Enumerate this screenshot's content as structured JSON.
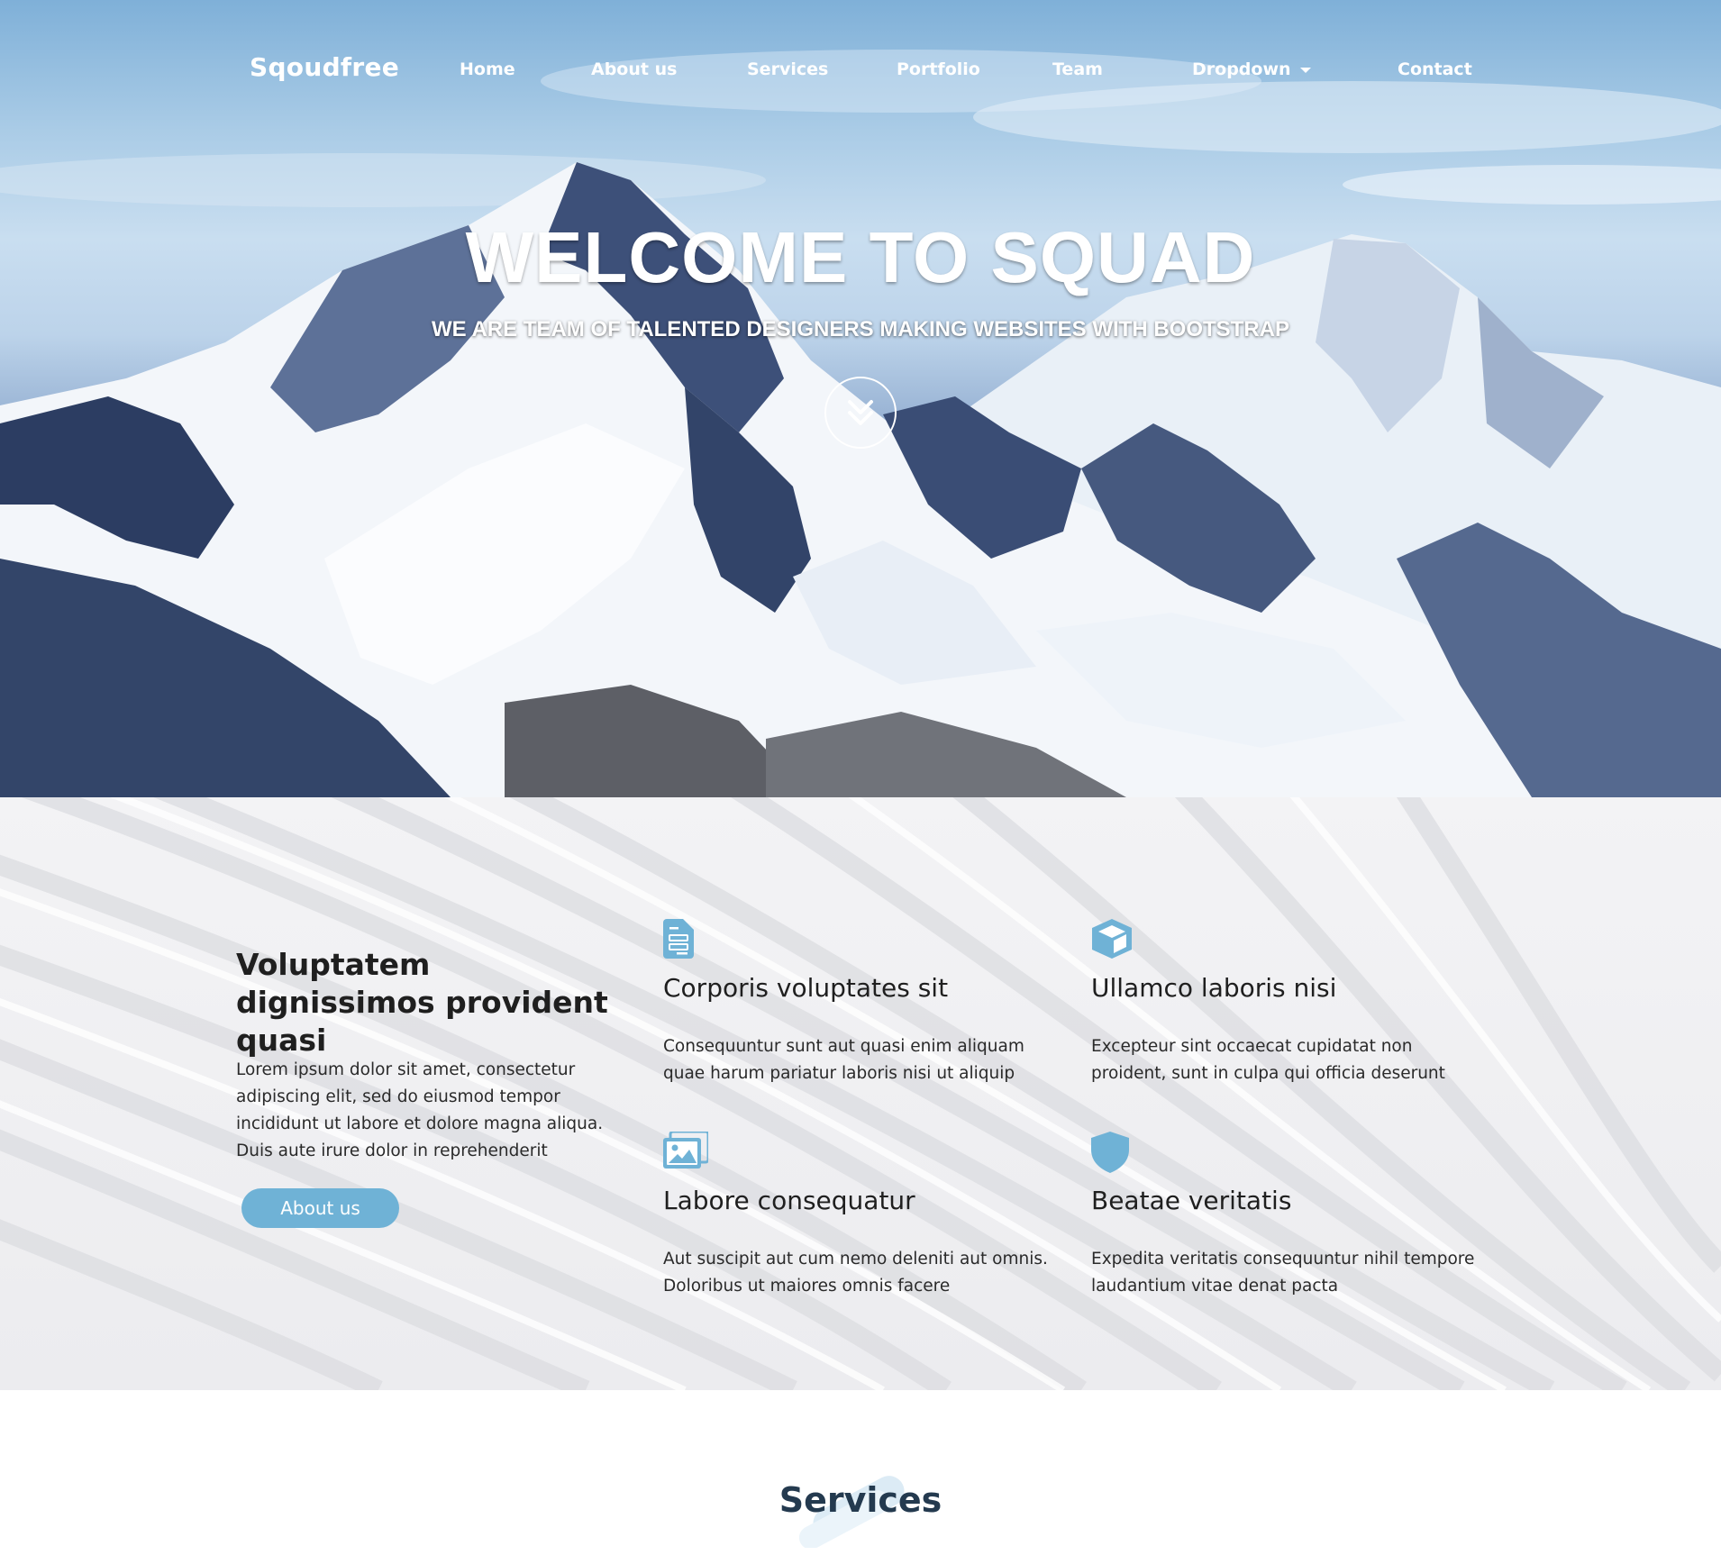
{
  "nav": {
    "brand": "Sqoudfree",
    "items": [
      {
        "label": "Home"
      },
      {
        "label": "About us"
      },
      {
        "label": "Services"
      },
      {
        "label": "Portfolio"
      },
      {
        "label": "Team"
      },
      {
        "label": "Dropdown"
      },
      {
        "label": "Contact"
      }
    ]
  },
  "hero": {
    "title": "WELCOME TO SQUAD",
    "subtitle": "WE ARE TEAM OF TALENTED DESIGNERS MAKING WEBSITES WITH BOOTSTRAP",
    "scroll_icon": "chevron-double-down-icon"
  },
  "intro": {
    "title": "Voluptatem dignissimos provident quasi",
    "text": "Lorem ipsum dolor sit amet, consectetur adipiscing elit, sed do eiusmod tempor incididunt ut labore et dolore magna aliqua. Duis aute irure dolor in reprehenderit",
    "button_label": "About us"
  },
  "features": [
    {
      "icon": "document-icon",
      "title": "Corporis voluptates sit",
      "text": "Consequuntur sunt aut quasi enim aliquam quae harum pariatur laboris nisi ut aliquip"
    },
    {
      "icon": "cube-icon",
      "title": "Ullamco laboris nisi",
      "text": "Excepteur sint occaecat cupidatat non proident, sunt in culpa qui officia deserunt"
    },
    {
      "icon": "images-icon",
      "title": "Labore consequatur",
      "text": "Aut suscipit aut cum nemo deleniti aut omnis. Doloribus ut maiores omnis facere"
    },
    {
      "icon": "shield-icon",
      "title": "Beatae veritatis",
      "text": "Expedita veritatis consequuntur nihil tempore laudantium vitae denat pacta"
    }
  ],
  "services": {
    "title": "Services"
  },
  "colors": {
    "accent": "#6fb2d6",
    "heading_dark": "#243a4f",
    "text": "#2a2a2a"
  }
}
